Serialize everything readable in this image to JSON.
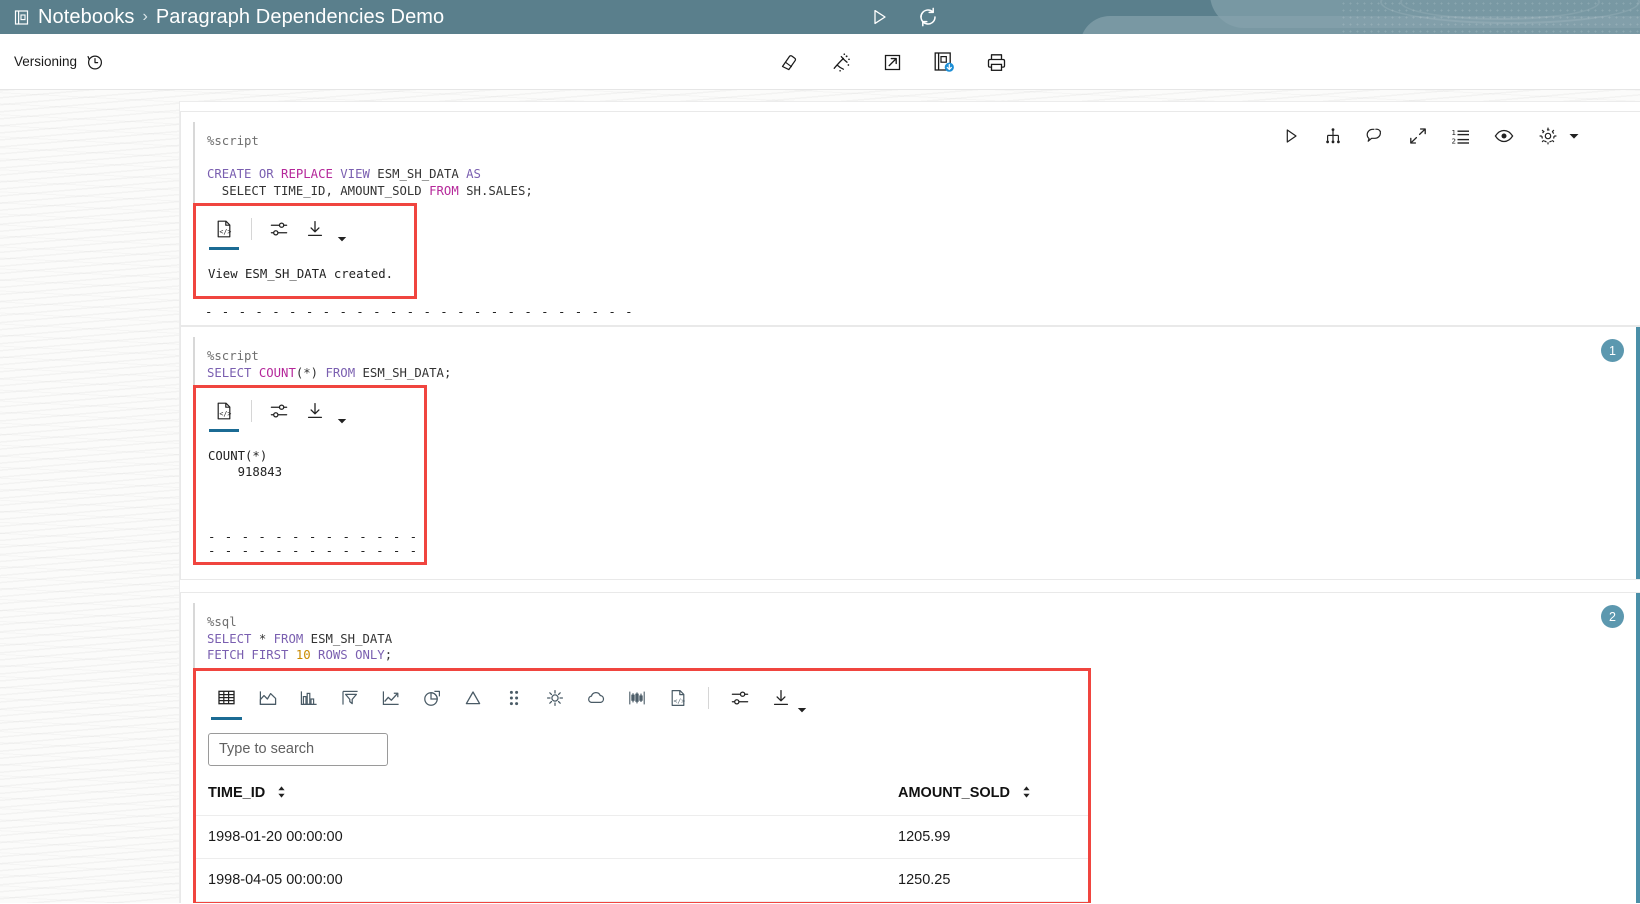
{
  "header": {
    "notebook_icon": "notebook-icon",
    "breadcrumb_root": "Notebooks",
    "breadcrumb_sep": "›",
    "breadcrumb_current": "Paragraph Dependencies Demo",
    "run_all_label": "run-all-icon",
    "refresh_label": "refresh-icon",
    "bg_color": "#5a7f8c"
  },
  "toolbar": {
    "versioning_label": "Versioning",
    "versioning_icon": "history-clock-icon",
    "actions": [
      {
        "name": "clear-results-icon",
        "title": "Clear all results"
      },
      {
        "name": "clear-all-icon",
        "title": "Clear"
      },
      {
        "name": "open-external-icon",
        "title": "Open in new window"
      },
      {
        "name": "save-notebook-icon",
        "title": "Save notebook"
      },
      {
        "name": "print-icon",
        "title": "Print"
      }
    ]
  },
  "paragraphs": [
    {
      "badge": "",
      "interpreter": "%script",
      "code_lines": [
        [
          {
            "t": "",
            "c": "k-plain"
          }
        ],
        [
          {
            "t": "CREATE",
            "c": "k-kw"
          },
          {
            "t": " ",
            "c": "k-plain"
          },
          {
            "t": "OR",
            "c": "k-kw"
          },
          {
            "t": " ",
            "c": "k-plain"
          },
          {
            "t": "REPLACE",
            "c": "k-kw2"
          },
          {
            "t": " ",
            "c": "k-plain"
          },
          {
            "t": "VIEW",
            "c": "k-kw"
          },
          {
            "t": " ESM_SH_DATA ",
            "c": "k-plain"
          },
          {
            "t": "AS",
            "c": "k-kw"
          }
        ],
        [
          {
            "t": "  SELECT TIME_ID, AMOUNT_SOLD ",
            "c": "k-plain"
          },
          {
            "t": "FROM",
            "c": "k-kw2"
          },
          {
            "t": " SH.SALES;",
            "c": "k-plain"
          }
        ]
      ],
      "result_tabs": [
        {
          "name": "result-raw-icon",
          "active": true
        },
        {
          "name": "result-settings-icon",
          "active": false
        },
        {
          "name": "result-download-icon",
          "active": false
        }
      ],
      "result_text": "View ESM_SH_DATA created.",
      "separator": "- - - - - - - - - - - - - - - - - - - - - - - - - -",
      "outline_width": 224,
      "outline_height": 104
    },
    {
      "badge": "1",
      "interpreter": "%script",
      "code_lines": [
        [
          {
            "t": "SELECT ",
            "c": "k-kw"
          },
          {
            "t": "COUNT",
            "c": "k-kw2"
          },
          {
            "t": "(*) ",
            "c": "k-plain"
          },
          {
            "t": "FROM",
            "c": "k-kw"
          },
          {
            "t": " ESM_SH_DATA;",
            "c": "k-plain"
          }
        ]
      ],
      "result_tabs": [
        {
          "name": "result-raw-icon",
          "active": true
        },
        {
          "name": "result-settings-icon",
          "active": false
        },
        {
          "name": "result-download-icon",
          "active": false
        }
      ],
      "result_text": "COUNT(*)\n    918843",
      "separator": "- - - - - - - - - - - - - - - - - - - - - - - - - -",
      "outline_width": 234,
      "outline_height": 152
    },
    {
      "badge": "2",
      "interpreter": "%sql",
      "code_lines": [
        [
          {
            "t": "SELECT",
            "c": "k-kw"
          },
          {
            "t": " * ",
            "c": "k-plain"
          },
          {
            "t": "FROM",
            "c": "k-kw"
          },
          {
            "t": " ESM_SH_DATA",
            "c": "k-plain"
          }
        ],
        [
          {
            "t": "FETCH FIRST ",
            "c": "k-kw"
          },
          {
            "t": "10",
            "c": "k-num"
          },
          {
            "t": " ROWS ONLY",
            "c": "k-kw"
          },
          {
            "t": ";",
            "c": "k-plain"
          }
        ]
      ]
    }
  ],
  "paragraph_actions": [
    {
      "name": "run-paragraph-icon"
    },
    {
      "name": "dependencies-icon"
    },
    {
      "name": "comment-icon"
    },
    {
      "name": "expand-icon"
    },
    {
      "name": "ordered-list-icon"
    },
    {
      "name": "visibility-eye-icon"
    },
    {
      "name": "paragraph-settings-gear-icon"
    },
    {
      "name": "paragraph-settings-caret-icon"
    }
  ],
  "viz": {
    "tabs": [
      {
        "name": "viz-grid-icon",
        "label": "Grid",
        "active": true
      },
      {
        "name": "viz-area-icon",
        "label": "Area",
        "active": false
      },
      {
        "name": "viz-bar-icon",
        "label": "Bar",
        "active": false
      },
      {
        "name": "viz-funnel-icon",
        "label": "Funnel",
        "active": false
      },
      {
        "name": "viz-line-icon",
        "label": "Line",
        "active": false
      },
      {
        "name": "viz-pie-icon",
        "label": "Pie",
        "active": false
      },
      {
        "name": "viz-pyramid-icon",
        "label": "Pyramid",
        "active": false
      },
      {
        "name": "viz-scatter-icon",
        "label": "Scatter",
        "active": false
      },
      {
        "name": "viz-sunburst-icon",
        "label": "Sunburst",
        "active": false
      },
      {
        "name": "viz-cloud-icon",
        "label": "Cloud",
        "active": false
      },
      {
        "name": "viz-candlestick-icon",
        "label": "Candlestick",
        "active": false
      },
      {
        "name": "viz-raw-icon",
        "label": "Raw",
        "active": false
      }
    ],
    "settings_icon": "viz-settings-icon",
    "download_icon": "viz-download-icon",
    "download_caret": "viz-download-caret-icon",
    "search_placeholder": "Type to search",
    "search_value": ""
  },
  "table": {
    "columns": [
      "TIME_ID",
      "AMOUNT_SOLD"
    ],
    "rows": [
      [
        "1998-01-20 00:00:00",
        "1205.99"
      ],
      [
        "1998-04-05 00:00:00",
        "1250.25"
      ]
    ]
  },
  "colors": {
    "header_teal": "#5a7f8c",
    "accent_bar": "#4a8fa8",
    "badge": "#5c98af",
    "highlight_outline": "#f0453f",
    "active_tab_underline": "#1b6b94"
  }
}
